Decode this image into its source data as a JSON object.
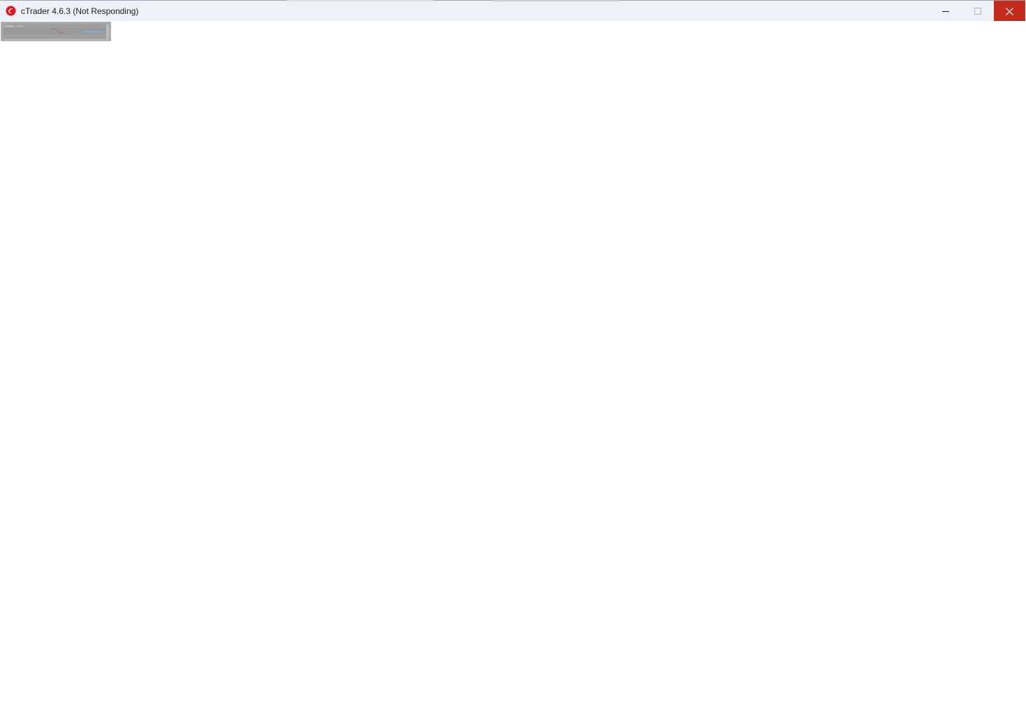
{
  "window": {
    "title": "cTrader 4.6.3 (Not Responding)",
    "app_icon": "ctrader-logo-icon",
    "controls": {
      "minimize": "minimize-icon",
      "maximize": "maximize-icon",
      "close": "close-icon"
    },
    "colors": {
      "titlebar": "#eef1f8",
      "close_button": "#c42b1c",
      "logo": "#e4151d"
    }
  },
  "client": {
    "preview_thumbnail": "chart-preview-thumbnail"
  }
}
